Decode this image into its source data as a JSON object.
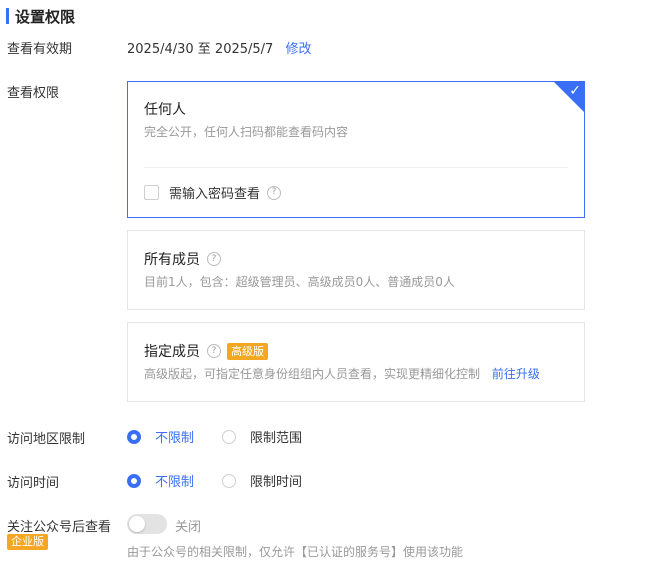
{
  "section": {
    "title": "设置权限"
  },
  "validity": {
    "label": "查看有效期",
    "value": "2025/4/30 至 2025/5/7",
    "edit_link": "修改"
  },
  "view_permission": {
    "label": "查看权限",
    "options": [
      {
        "title": "任何人",
        "desc": "完全公开，任何人扫码都能查看码内容",
        "checkbox_label": "需输入密码查看",
        "help": "?"
      },
      {
        "title": "所有成员",
        "help": "?",
        "desc": "目前1人，包含：超级管理员、高级成员0人、普通成员0人"
      },
      {
        "title": "指定成员",
        "help": "?",
        "badge": "高级版",
        "desc": "高级版起，可指定任意身份组组内人员查看，实现更精细化控制",
        "link": "前往升级"
      }
    ]
  },
  "region": {
    "label": "访问地区限制",
    "options": [
      "不限制",
      "限制范围"
    ],
    "selected": 0
  },
  "time": {
    "label": "访问时间",
    "options": [
      "不限制",
      "限制时间"
    ],
    "selected": 0
  },
  "follow": {
    "label": "关注公众号后查看",
    "badge": "企业版",
    "toggle_state": "关闭",
    "note": "由于公众号的相关限制，仅允许【已认证的服务号】使用该功能"
  },
  "colors": {
    "accent": "#3a6ff5",
    "badge": "#f5a623"
  }
}
